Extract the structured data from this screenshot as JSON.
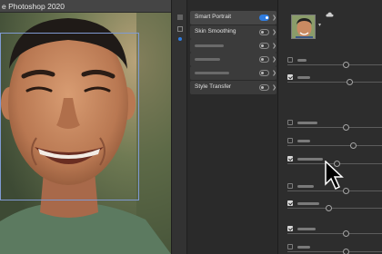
{
  "app": {
    "title": "e Photoshop 2020"
  },
  "filters": [
    {
      "label": "Smart Portrait",
      "enabled": true,
      "active": true
    },
    {
      "label": "Skin Smoothing",
      "enabled": false,
      "active": false
    },
    {
      "label": "",
      "enabled": false,
      "active": false
    },
    {
      "label": "",
      "enabled": false,
      "active": false
    },
    {
      "label": "",
      "enabled": false,
      "active": false
    },
    {
      "label": "Style Transfer",
      "enabled": false,
      "active": false
    }
  ],
  "settings": {
    "rows": [
      {
        "checked": false,
        "level": 0.62
      },
      {
        "checked": true,
        "level": 0.66
      },
      {
        "checked": false,
        "level": 0.62
      },
      {
        "checked": false,
        "level": 0.7
      },
      {
        "checked": true,
        "level": 0.52
      },
      {
        "checked": false,
        "level": 0.62
      },
      {
        "checked": true,
        "level": 0.44
      },
      {
        "checked": true,
        "level": 0.62
      },
      {
        "checked": false,
        "level": 0.62
      }
    ]
  },
  "colors": {
    "accent": "#2f7ce0",
    "face_box": "#7f9ad2"
  }
}
